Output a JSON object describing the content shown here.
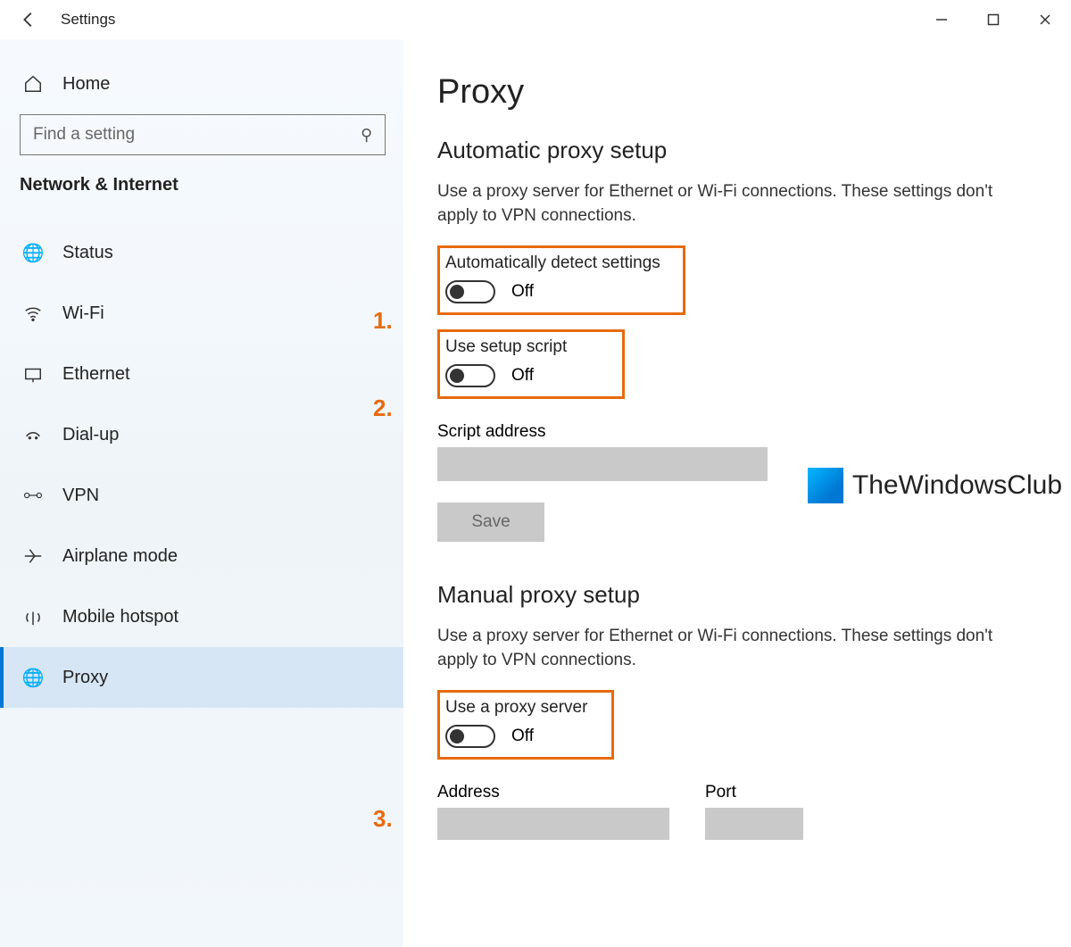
{
  "window": {
    "title": "Settings"
  },
  "sidebar": {
    "home": "Home",
    "search_placeholder": "Find a setting",
    "section": "Network & Internet",
    "items": [
      {
        "label": "Status",
        "icon": "globe-icon"
      },
      {
        "label": "Wi-Fi",
        "icon": "wifi-icon"
      },
      {
        "label": "Ethernet",
        "icon": "ethernet-icon"
      },
      {
        "label": "Dial-up",
        "icon": "dialup-icon"
      },
      {
        "label": "VPN",
        "icon": "vpn-icon"
      },
      {
        "label": "Airplane mode",
        "icon": "airplane-icon"
      },
      {
        "label": "Mobile hotspot",
        "icon": "hotspot-icon"
      },
      {
        "label": "Proxy",
        "icon": "globe-icon",
        "active": true
      }
    ]
  },
  "page": {
    "title": "Proxy",
    "auto": {
      "heading": "Automatic proxy setup",
      "desc": "Use a proxy server for Ethernet or Wi-Fi connections. These settings don't apply to VPN connections.",
      "detect_label": "Automatically detect settings",
      "detect_state": "Off",
      "script_label": "Use setup script",
      "script_state": "Off",
      "script_addr_label": "Script address",
      "script_addr_value": "",
      "save_label": "Save"
    },
    "manual": {
      "heading": "Manual proxy setup",
      "desc": "Use a proxy server for Ethernet or Wi-Fi connections. These settings don't apply to VPN connections.",
      "use_label": "Use a proxy server",
      "use_state": "Off",
      "address_label": "Address",
      "address_value": "",
      "port_label": "Port",
      "port_value": ""
    }
  },
  "annotations": {
    "n1": "1.",
    "n2": "2.",
    "n3": "3."
  },
  "watermark": "TheWindowsClub"
}
